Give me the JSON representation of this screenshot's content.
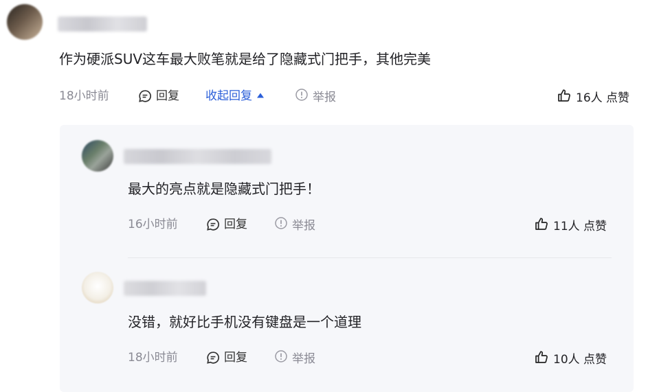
{
  "comment": {
    "text": "作为硬派SUV这车最大败笔就是给了隐藏式门把手，其他完美",
    "time": "18小时前",
    "reply_label": "回复",
    "collapse_label": "收起回复",
    "report_label": "举报",
    "likes_label": "16人 点赞"
  },
  "replies": [
    {
      "text": "最大的亮点就是隐藏式门把手！",
      "time": "16小时前",
      "reply_label": "回复",
      "report_label": "举报",
      "likes_label": "11人 点赞"
    },
    {
      "text": "没错，就好比手机没有键盘是一个道理",
      "time": "18小时前",
      "reply_label": "回复",
      "report_label": "举报",
      "likes_label": "10人 点赞"
    }
  ],
  "colors": {
    "link_blue": "#2b5fd9",
    "muted": "#8a8a94",
    "reply_bg": "#f6f7fa"
  }
}
